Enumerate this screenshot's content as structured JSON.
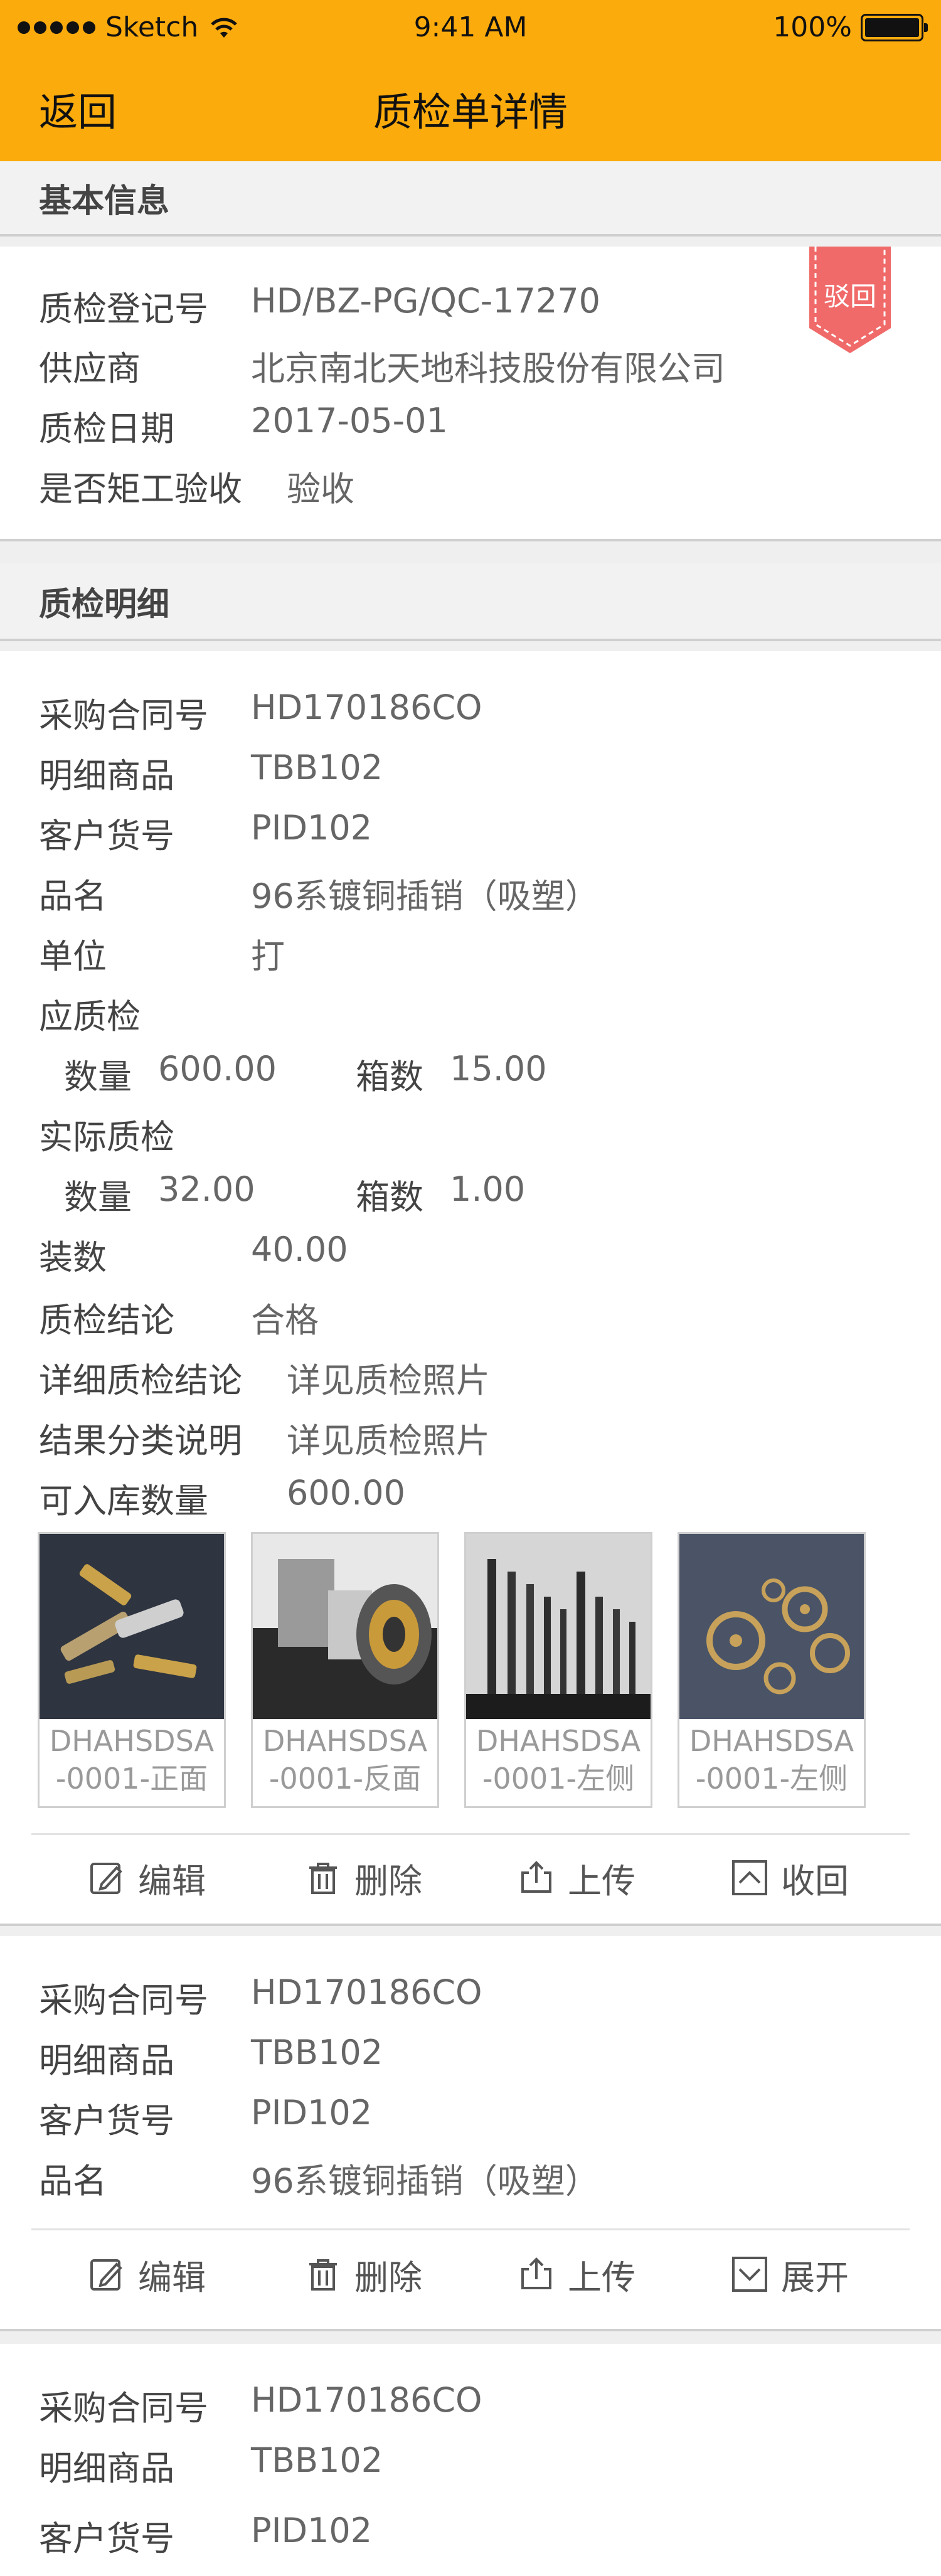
{
  "status_bar": {
    "carrier": "Sketch",
    "time": "9:41 AM",
    "battery": "100%"
  },
  "nav": {
    "back_label": "返回",
    "title": "质检单详情"
  },
  "basic_info": {
    "title": "基本信息",
    "stamp_label": "驳回",
    "rows": [
      {
        "label": "质检登记号",
        "value": "HD/BZ-PG/QC-17270"
      },
      {
        "label": "供应商",
        "value": "北京南北天地科技股份有限公司"
      },
      {
        "label": "质检日期",
        "value": "2017-05-01"
      },
      {
        "label": "是否矩工验收",
        "value": "验收"
      }
    ]
  },
  "detail": {
    "title": "质检明细",
    "item1": {
      "contract_label": "采购合同号",
      "contract": "HD170186CO",
      "goods_label": "明细商品",
      "goods": "TBB102",
      "customer_no_label": "客户货号",
      "customer_no": "PID102",
      "name_label": "品名",
      "name": "96系镀铜插销（吸塑）",
      "unit_label": "单位",
      "unit": "打",
      "should_label": "应质检",
      "should_qty_label": "数量",
      "should_qty": "600.00",
      "should_box_label": "箱数",
      "should_box": "15.00",
      "actual_label": "实际质检",
      "actual_qty_label": "数量",
      "actual_qty": "32.00",
      "actual_box_label": "箱数",
      "actual_box": "1.00",
      "pack_label": "装数",
      "pack": "40.00",
      "conclusion_label": "质检结论",
      "conclusion": "合格",
      "detail_conclusion_label": "详细质检结论",
      "detail_conclusion": "详见质检照片",
      "result_label": "结果分类说明",
      "result": "详见质检照片",
      "storable_label": "可入库数量",
      "storable": "600.00",
      "photos": [
        {
          "line1": "DHAHSDSA",
          "line2": "-0001-正面"
        },
        {
          "line1": "DHAHSDSA",
          "line2": "-0001-反面"
        },
        {
          "line1": "DHAHSDSA",
          "line2": "-0001-左侧"
        },
        {
          "line1": "DHAHSDSA",
          "line2": "-0001-左侧"
        }
      ],
      "actions": {
        "edit": "编辑",
        "delete": "删除",
        "upload": "上传",
        "collapse": "收回"
      }
    },
    "item2": {
      "contract_label": "采购合同号",
      "contract": "HD170186CO",
      "goods_label": "明细商品",
      "goods": "TBB102",
      "customer_no_label": "客户货号",
      "customer_no": "PID102",
      "name_label": "品名",
      "name": "96系镀铜插销（吸塑）",
      "actions": {
        "edit": "编辑",
        "delete": "删除",
        "upload": "上传",
        "expand": "展开"
      }
    },
    "item3": {
      "contract_label": "采购合同号",
      "contract": "HD170186CO",
      "goods_label": "明细商品",
      "goods": "TBB102",
      "customer_no_label": "客户货号",
      "customer_no": "PID102"
    }
  },
  "colors": {
    "header": "#fcab0d",
    "stamp": "#f06a6a"
  }
}
